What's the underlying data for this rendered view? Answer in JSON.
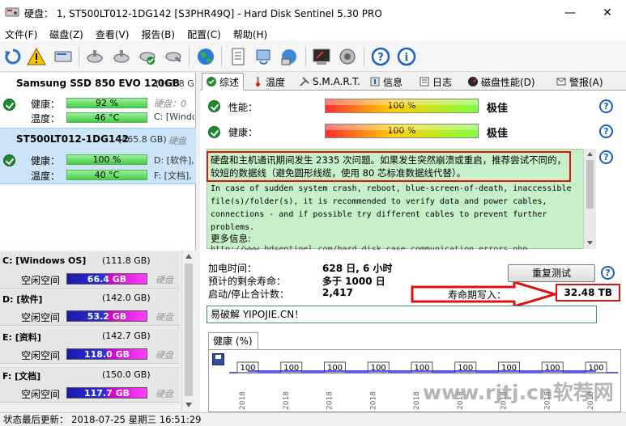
{
  "window": {
    "title": "硬盘： 1, ST500LT012-1DG142 [S3PHR49Q]  -  Hard Disk Sentinel 5.30 PRO",
    "minimize": "—",
    "maximize": "☐",
    "close": "✕"
  },
  "menu": [
    "文件(F)",
    "磁盘(Z)",
    "查看(V)",
    "报告(B)",
    "配置(C)",
    "帮助(H)"
  ],
  "toolbar_icons": [
    "refresh-icon",
    "warning-icon",
    "disk-icon",
    "satellite-icon",
    "satellite-icon",
    "satellite-check-icon",
    "satellite-tool-icon",
    "globe-icon",
    "document-icon",
    "network-refresh-icon",
    "network-icon",
    "terminal-icon",
    "speaker-icon",
    "help-icon",
    "info-icon"
  ],
  "disks": [
    {
      "name": "Samsung SSD 850 EVO 120GB",
      "size": "(111.8 G",
      "health_label": "健康：",
      "health_value": "92 %",
      "health_cut": "硬盘：0",
      "temp_label": "温度：",
      "temp_value": "46 °C",
      "temp_cut": "C: [Windo"
    },
    {
      "name": "ST500LT012-1DG142",
      "size": "(465.8 GB)",
      "size_cut": "硬盘",
      "health_label": "健康：",
      "health_value": "100 %",
      "health_cut": "D: [软件],",
      "temp_label": "温度：",
      "temp_value": "40 °C",
      "temp_cut": "F: [文档],"
    }
  ],
  "partitions": [
    {
      "name": "C: [Windows OS]",
      "size": "(111.8 GB)",
      "free_label": "空闲空间",
      "free": "66.4 GB",
      "disk": "硬盘"
    },
    {
      "name": "D: [软件]",
      "size": "(142.0 GB)",
      "free_label": "空闲空间",
      "free": "53.2 GB",
      "disk": "硬盘"
    },
    {
      "name": "E: [资料]",
      "size": "(142.7 GB)",
      "free_label": "空闲空间",
      "free": "118.0 GB",
      "disk": "硬盘"
    },
    {
      "name": "F: [文档]",
      "size": "(150.0 GB)",
      "free_label": "空闲空间",
      "free": "117.7 GB",
      "disk": "硬盘"
    }
  ],
  "tabs": [
    "综述",
    "温度",
    "S.M.A.R.T.",
    "信息",
    "日志",
    "磁盘性能(D)",
    "警报(A)"
  ],
  "metrics": {
    "performance_label": "性能：",
    "performance_value": "100 %",
    "performance_grade": "极佳",
    "health_label": "健康：",
    "health_value": "100 %",
    "health_grade": "极佳",
    "help": "?"
  },
  "info": {
    "chinese": "硬盘和主机通讯期间发生 2335 次问题。如果发生突然崩溃或重启，推荐尝试不同的，较短的数据线（避免圆形线缆，使用 80 芯标准数据线代替）。",
    "english": "In case of sudden system crash, reboot, blue-screen-of-death, inaccessible file(s)/folder(s), it is recommended to verify data and power cables, connections - and if possible try different cables to prevent further problems.",
    "more": "更多信息:",
    "url": "http://www.hdsentinel.com/hard_disk_case_communication_errors.php"
  },
  "stats": {
    "power_on_label": "加电时间：",
    "power_on_value": "628 日, 6 小时",
    "remaining_label": "预计的剩余寿命：",
    "remaining_value": "多于 1000 日",
    "startstop_label": "启动/停止合计数：",
    "startstop_value": "2,417",
    "lifetime_label": "寿命期写入：",
    "lifetime_value": "32.48 TB",
    "retest_button": "重复测试"
  },
  "comment": "易破解 YIPOJIE.CN！",
  "health_tab": "健康 (%)",
  "chart_data": {
    "type": "line",
    "title": "健康 (%)",
    "data_labels": [
      "100",
      "100",
      "100",
      "100",
      "100",
      "100",
      "100",
      "100",
      "100"
    ],
    "x": [
      "2018",
      "2018",
      "2018",
      "2018",
      "2018",
      "2018",
      "2018",
      "2018",
      "2018"
    ],
    "values": [
      100,
      100,
      100,
      100,
      100,
      100,
      100,
      100,
      100
    ],
    "series_color": "#2a2ad8"
  },
  "watermark": "www.rjtj.cn软荐网",
  "statusbar": "状态最后更新： 2018-07-25 星期三 16:51:29",
  "colors": {
    "red_highlight": "#e01010",
    "green_bar": "#46cc46",
    "info_bg": "#c8f0c8"
  }
}
